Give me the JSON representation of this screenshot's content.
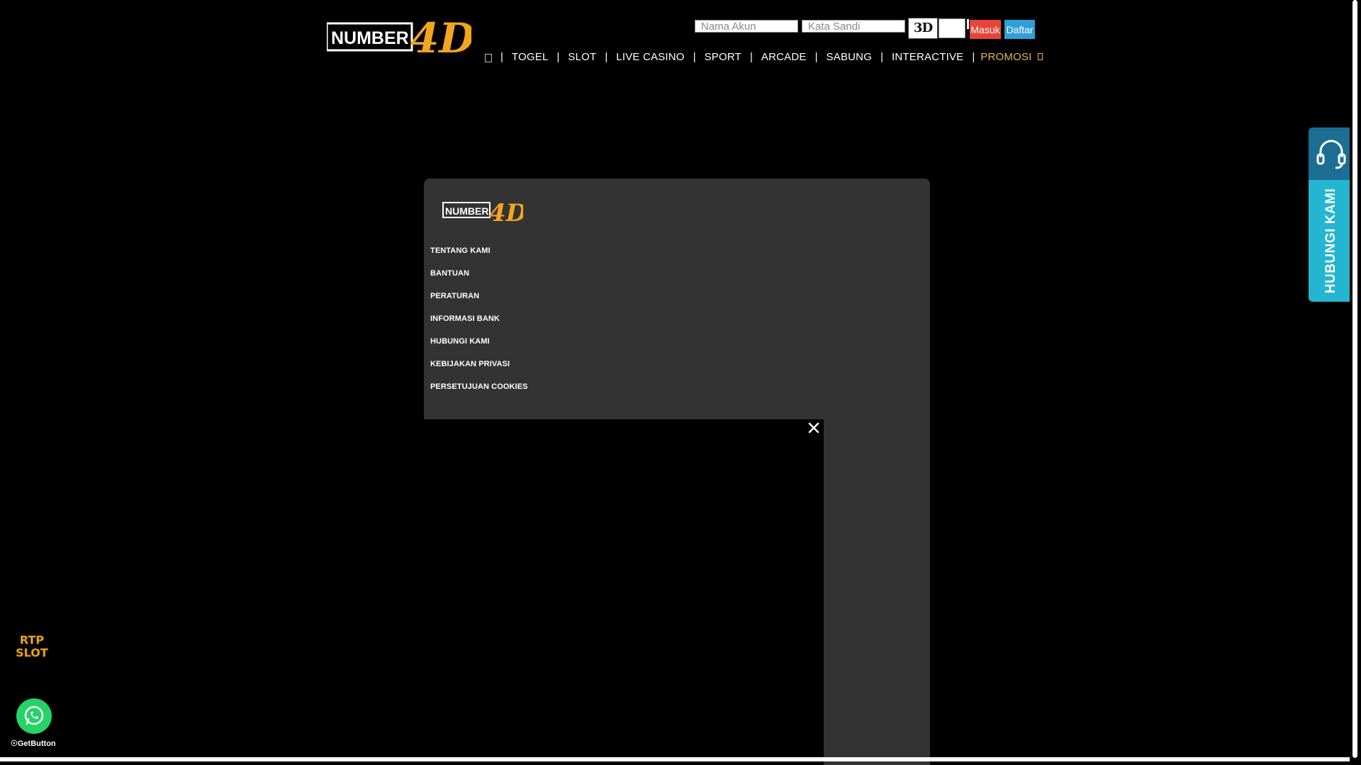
{
  "brand": {
    "name_left": "NUMBER",
    "name_right": "4D"
  },
  "login": {
    "username_placeholder": "Nama Akun",
    "password_placeholder": "Kata Sandi",
    "captcha_text": "3D",
    "login_label": "Masuk",
    "register_label": "Daftar"
  },
  "nav": {
    "items": [
      "TOGEL",
      "SLOT",
      "LIVE CASINO",
      "SPORT",
      "ARCADE",
      "SABUNG",
      "INTERACTIVE"
    ],
    "separator": "|",
    "promo": "PROMOSI"
  },
  "footer": {
    "links": [
      "TENTANG KAMI",
      "BANTUAN",
      "PERATURAN",
      "INFORMASI BANK",
      "HUBUNGI KAMI",
      "KEBIJAKAN PRIVASI",
      "PERSETUJUAN COOKIES"
    ]
  },
  "contact": {
    "label": "HUBUNGI KAMI"
  },
  "rtp": {
    "line1": "RTP",
    "line2": "SLOT"
  },
  "getbutton": {
    "label": "GetButton"
  },
  "colors": {
    "accent_gold": "#e6b64f",
    "login_button": "#e8443a",
    "register_button": "#2f9fd6",
    "contact_tab": "#24b6d1",
    "contact_tab_top": "#1c6e93",
    "panel": "#333333",
    "whatsapp": "#25d366"
  }
}
